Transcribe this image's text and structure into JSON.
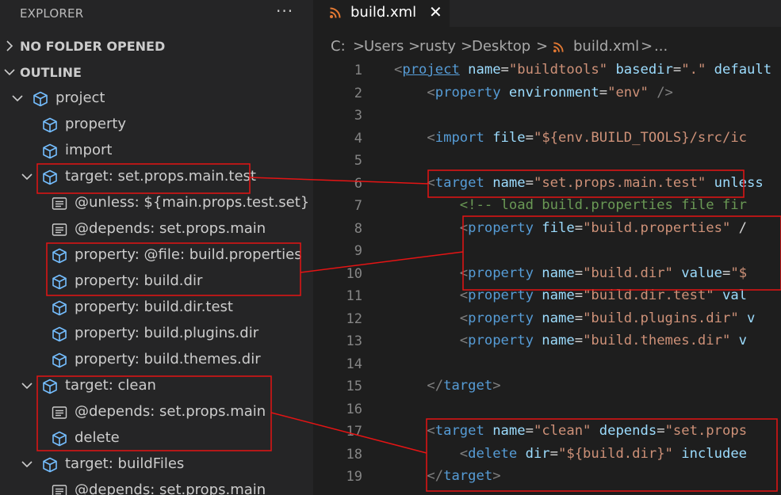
{
  "sidebar": {
    "title": "EXPLORER",
    "more_label": "···",
    "sections": [
      {
        "label": "NO FOLDER OPENED",
        "expanded": false
      },
      {
        "label": "OUTLINE",
        "expanded": true
      }
    ],
    "outline": [
      {
        "label": "project",
        "icon": "cube-icon",
        "chev": "down"
      },
      {
        "label": "property",
        "icon": "cube-icon"
      },
      {
        "label": "import",
        "icon": "cube-icon"
      },
      {
        "label": "target: set.props.main.test",
        "icon": "cube-icon",
        "chev": "down"
      },
      {
        "label": "@unless: ${main.props.test.set}",
        "icon": "attribute-icon"
      },
      {
        "label": "@depends: set.props.main",
        "icon": "attribute-icon"
      },
      {
        "label": "property: @file: build.properties",
        "icon": "cube-icon"
      },
      {
        "label": "property: build.dir",
        "icon": "cube-icon"
      },
      {
        "label": "property: build.dir.test",
        "icon": "cube-icon"
      },
      {
        "label": "property: build.plugins.dir",
        "icon": "cube-icon"
      },
      {
        "label": "property: build.themes.dir",
        "icon": "cube-icon"
      },
      {
        "label": "target: clean",
        "icon": "cube-icon",
        "chev": "down"
      },
      {
        "label": "@depends: set.props.main",
        "icon": "attribute-icon"
      },
      {
        "label": "delete",
        "icon": "cube-icon"
      },
      {
        "label": "target: buildFiles",
        "icon": "cube-icon",
        "chev": "down"
      },
      {
        "label": "@depends: set.props.main",
        "icon": "attribute-icon"
      }
    ]
  },
  "editor": {
    "tab": {
      "label": "build.xml",
      "close_label": "✕",
      "icon": "rss-icon"
    },
    "breadcrumbs": [
      "C:",
      "Users",
      "rusty",
      "Desktop",
      "build.xml",
      "..."
    ],
    "lines": [
      {
        "n": "1",
        "tokens": [
          [
            "b",
            "<"
          ],
          [
            "tu",
            "project"
          ],
          [
            "a",
            " name"
          ],
          [
            "e",
            "="
          ],
          [
            "s",
            "\"buildtools\""
          ],
          [
            "a",
            " basedir"
          ],
          [
            "e",
            "="
          ],
          [
            "s",
            "\".\""
          ],
          [
            "a",
            " default"
          ]
        ]
      },
      {
        "n": "2",
        "tokens": [
          [
            "p",
            "    "
          ],
          [
            "b",
            "<"
          ],
          [
            "t",
            "property"
          ],
          [
            "a",
            " environment"
          ],
          [
            "e",
            "="
          ],
          [
            "s",
            "\"env\""
          ],
          [
            "b",
            " />"
          ]
        ]
      },
      {
        "n": "3",
        "tokens": []
      },
      {
        "n": "4",
        "tokens": [
          [
            "p",
            "    "
          ],
          [
            "b",
            "<"
          ],
          [
            "t",
            "import"
          ],
          [
            "a",
            " file"
          ],
          [
            "e",
            "="
          ],
          [
            "s",
            "\"${env.BUILD_TOOLS}/src/ic"
          ]
        ]
      },
      {
        "n": "5",
        "tokens": []
      },
      {
        "n": "6",
        "tokens": [
          [
            "p",
            "    "
          ],
          [
            "b",
            "<"
          ],
          [
            "t",
            "target"
          ],
          [
            "a",
            " name"
          ],
          [
            "e",
            "="
          ],
          [
            "s",
            "\"set.props.main.test\""
          ],
          [
            "a",
            " unless"
          ]
        ]
      },
      {
        "n": "7",
        "tokens": [
          [
            "p",
            "        "
          ],
          [
            "c",
            "<!-- load build.properties file fir"
          ]
        ]
      },
      {
        "n": "8",
        "tokens": [
          [
            "p",
            "        "
          ],
          [
            "b",
            "<"
          ],
          [
            "t",
            "property"
          ],
          [
            "a",
            " file"
          ],
          [
            "e",
            "="
          ],
          [
            "s",
            "\"build.properties\""
          ],
          [
            "e",
            " /"
          ]
        ]
      },
      {
        "n": "9",
        "tokens": []
      },
      {
        "n": "10",
        "tokens": [
          [
            "p",
            "        "
          ],
          [
            "b",
            "<"
          ],
          [
            "t",
            "property"
          ],
          [
            "a",
            " name"
          ],
          [
            "e",
            "="
          ],
          [
            "s",
            "\"build.dir\""
          ],
          [
            "a",
            " value"
          ],
          [
            "e",
            "="
          ],
          [
            "s",
            "\"$"
          ]
        ]
      },
      {
        "n": "11",
        "tokens": [
          [
            "p",
            "        "
          ],
          [
            "b",
            "<"
          ],
          [
            "t",
            "property"
          ],
          [
            "a",
            " name"
          ],
          [
            "e",
            "="
          ],
          [
            "s",
            "\"build.dir.test\""
          ],
          [
            "a",
            " val"
          ]
        ]
      },
      {
        "n": "12",
        "tokens": [
          [
            "p",
            "        "
          ],
          [
            "b",
            "<"
          ],
          [
            "t",
            "property"
          ],
          [
            "a",
            " name"
          ],
          [
            "e",
            "="
          ],
          [
            "s",
            "\"build.plugins.dir\""
          ],
          [
            "a",
            " v"
          ]
        ]
      },
      {
        "n": "13",
        "tokens": [
          [
            "p",
            "        "
          ],
          [
            "b",
            "<"
          ],
          [
            "t",
            "property"
          ],
          [
            "a",
            " name"
          ],
          [
            "e",
            "="
          ],
          [
            "s",
            "\"build.themes.dir\""
          ],
          [
            "a",
            " v"
          ]
        ]
      },
      {
        "n": "14",
        "tokens": []
      },
      {
        "n": "15",
        "tokens": [
          [
            "p",
            "    "
          ],
          [
            "b",
            "</"
          ],
          [
            "t",
            "target"
          ],
          [
            "b",
            ">"
          ]
        ]
      },
      {
        "n": "16",
        "tokens": []
      },
      {
        "n": "17",
        "tokens": [
          [
            "p",
            "    "
          ],
          [
            "b",
            "<"
          ],
          [
            "t",
            "target"
          ],
          [
            "a",
            " name"
          ],
          [
            "e",
            "="
          ],
          [
            "s",
            "\"clean\""
          ],
          [
            "a",
            " depends"
          ],
          [
            "e",
            "="
          ],
          [
            "s",
            "\"set.props"
          ]
        ]
      },
      {
        "n": "18",
        "tokens": [
          [
            "p",
            "        "
          ],
          [
            "b",
            "<"
          ],
          [
            "t",
            "delete"
          ],
          [
            "a",
            " dir"
          ],
          [
            "e",
            "="
          ],
          [
            "s",
            "\"${build.dir}\""
          ],
          [
            "a",
            " includee"
          ]
        ]
      },
      {
        "n": "19",
        "tokens": [
          [
            "p",
            "    "
          ],
          [
            "b",
            "</"
          ],
          [
            "t",
            "target"
          ],
          [
            "b",
            ">"
          ]
        ]
      }
    ]
  },
  "colors": {
    "annotation": "#e51414",
    "icon_blue": "#75beff",
    "tab_icon": "#e37933"
  }
}
